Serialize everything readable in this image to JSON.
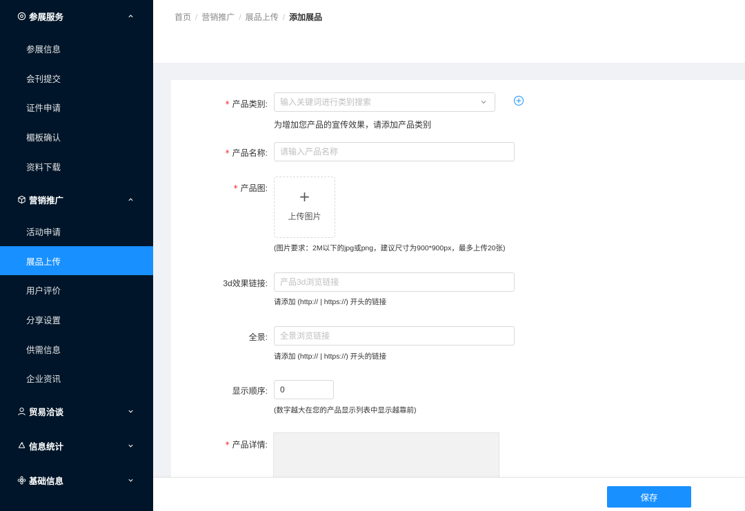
{
  "sidebar": {
    "groups": [
      {
        "label": "参展服务",
        "icon": "target-icon",
        "expanded": true
      },
      {
        "label": "营销推广",
        "icon": "cube-icon",
        "expanded": true
      },
      {
        "label": "贸易洽谈",
        "icon": "user-icon",
        "expanded": false
      },
      {
        "label": "信息统计",
        "icon": "recycle-icon",
        "expanded": false
      },
      {
        "label": "基础信息",
        "icon": "flower-icon",
        "expanded": false
      }
    ],
    "service_items": [
      "参展信息",
      "会刊提交",
      "证件申请",
      "楣板确认",
      "资料下载"
    ],
    "marketing_items": [
      "活动申请",
      "展品上传",
      "用户评价",
      "分享设置",
      "供需信息",
      "企业资讯"
    ],
    "active_item": "展品上传"
  },
  "breadcrumb": [
    "首页",
    "营销推广",
    "展品上传",
    "添加展品"
  ],
  "form": {
    "category": {
      "label": "产品类别:",
      "placeholder": "输入关键词进行类别搜索",
      "help": "为增加您产品的宣传效果，请添加产品类别"
    },
    "name": {
      "label": "产品名称:",
      "placeholder": "请输入产品名称"
    },
    "image": {
      "label": "产品图:",
      "upload_text": "上传图片",
      "plus": "+",
      "help": "(图片要求：2M以下的jpg或png，建议尺寸为900*900px，最多上传20张)"
    },
    "link3d": {
      "label": "3d效果链接:",
      "placeholder": "产品3d浏览链接",
      "help": "请添加 (http:// | https://) 开头的链接"
    },
    "panorama": {
      "label": "全景:",
      "placeholder": "全景浏览链接",
      "help": "请添加 (http:// | https://) 开头的链接"
    },
    "order": {
      "label": "显示顺序:",
      "value": "0",
      "help": "(数字越大在您的产品显示列表中显示越靠前)"
    },
    "detail": {
      "label": "产品详情:"
    },
    "required_mark": "*"
  },
  "footer": {
    "save_label": "保存"
  },
  "colors": {
    "sidebar_bg": "#001529",
    "accent": "#1890ff",
    "required": "#f5222d"
  }
}
